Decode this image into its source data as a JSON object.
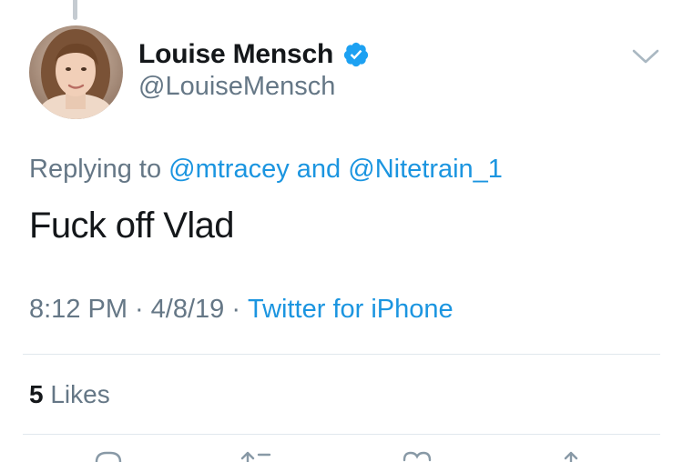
{
  "user": {
    "display_name": "Louise Mensch",
    "handle": "@LouiseMensch",
    "verified": true
  },
  "replying_to": {
    "prefix": "Replying to",
    "users": [
      "@mtracey",
      "@Nitetrain_1"
    ],
    "joiner": "and"
  },
  "tweet": {
    "text": "Fuck off Vlad",
    "time": "8:12 PM",
    "date": "4/8/19",
    "source": "Twitter for iPhone",
    "separator": "·"
  },
  "stats": {
    "likes_count": "5",
    "likes_label": "Likes"
  },
  "icons": {
    "verified": "verified-badge-icon",
    "menu": "chevron-down-icon",
    "reply": "reply-icon",
    "retweet": "retweet-icon",
    "like": "heart-icon",
    "share": "share-icon"
  },
  "colors": {
    "link": "#1b95e0",
    "secondary_text": "#657786",
    "primary_text": "#14171a",
    "verified": "#1da1f2",
    "divider": "#e1e8ed"
  }
}
